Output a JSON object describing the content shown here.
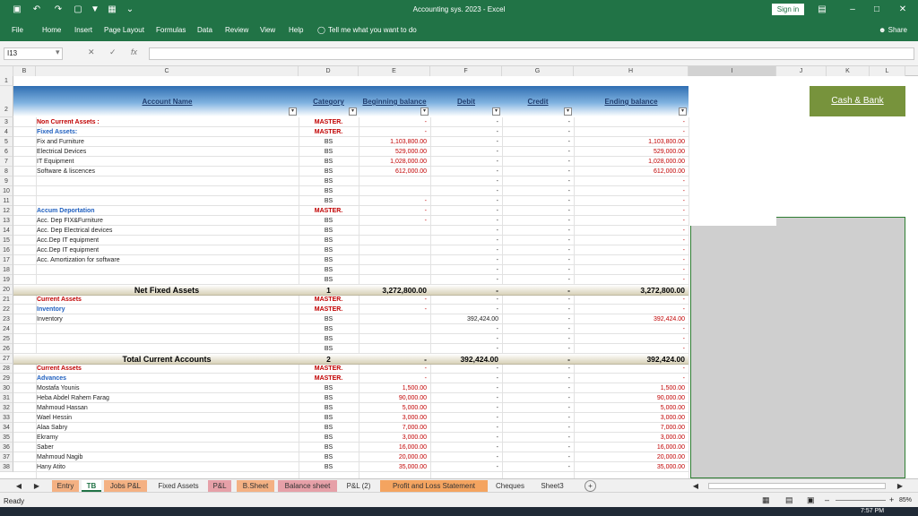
{
  "window": {
    "title": "Accounting sys. 2023  -  Excel",
    "signin": "Sign in"
  },
  "ribbon": {
    "tabs": [
      "File",
      "Home",
      "Insert",
      "Page Layout",
      "Formulas",
      "Data",
      "Review",
      "View",
      "Help"
    ],
    "tell_me": "Tell me what you want to do",
    "share": "Share"
  },
  "formula_bar": {
    "name_box": "I13",
    "formula": ""
  },
  "columns": [
    "B",
    "C",
    "D",
    "E",
    "F",
    "G",
    "H",
    "I",
    "J",
    "K",
    "L"
  ],
  "headers": {
    "account": "Account Name",
    "category": "Category",
    "beginning": "Beginning balance",
    "debit": "Debit",
    "credit": "Credit",
    "ending": "Ending balance"
  },
  "cash_bank": "Cash & Bank",
  "rows": [
    {
      "n": "3",
      "name": "Non Current Assets :",
      "cat": "MASTER.",
      "beg": "-",
      "deb": "-",
      "cre": "-",
      "end": "-",
      "style": "sect-red"
    },
    {
      "n": "4",
      "name": "Fixed Assets:",
      "cat": "MASTER.",
      "beg": "-",
      "deb": "-",
      "cre": "-",
      "end": "-",
      "style": "sect-blue"
    },
    {
      "n": "5",
      "name": "Fix and Furniture",
      "cat": "BS",
      "beg": "1,103,800.00",
      "deb": "-",
      "cre": "-",
      "end": "1,103,800.00",
      "style": ""
    },
    {
      "n": "6",
      "name": "Electrical Devices",
      "cat": "BS",
      "beg": "529,000.00",
      "deb": "-",
      "cre": "-",
      "end": "529,000.00",
      "style": ""
    },
    {
      "n": "7",
      "name": "IT Equipment",
      "cat": "BS",
      "beg": "1,028,000.00",
      "deb": "-",
      "cre": "-",
      "end": "1,028,000.00",
      "style": ""
    },
    {
      "n": "8",
      "name": "Software & liscences",
      "cat": "BS",
      "beg": "612,000.00",
      "deb": "-",
      "cre": "-",
      "end": "612,000.00",
      "style": ""
    },
    {
      "n": "9",
      "name": "",
      "cat": "BS",
      "beg": "",
      "deb": "-",
      "cre": "-",
      "end": "-",
      "style": ""
    },
    {
      "n": "10",
      "name": "",
      "cat": "BS",
      "beg": "",
      "deb": "-",
      "cre": "-",
      "end": "-",
      "style": ""
    },
    {
      "n": "11",
      "name": "",
      "cat": "BS",
      "beg": "-",
      "deb": "-",
      "cre": "-",
      "end": "-",
      "style": ""
    },
    {
      "n": "12",
      "name": "Accum Deportation",
      "cat": "MASTER.",
      "beg": "-",
      "deb": "-",
      "cre": "-",
      "end": "-",
      "style": "sect-blue"
    },
    {
      "n": "13",
      "name": "Acc. Dep  FIX&Furniture",
      "cat": "BS",
      "beg": "-",
      "deb": "-",
      "cre": "-",
      "end": "-",
      "style": ""
    },
    {
      "n": "14",
      "name": "Acc. Dep Electrical devices",
      "cat": "BS",
      "beg": "",
      "deb": "-",
      "cre": "-",
      "end": "-",
      "style": ""
    },
    {
      "n": "15",
      "name": "Acc.Dep IT equipment",
      "cat": "BS",
      "beg": "",
      "deb": "-",
      "cre": "-",
      "end": "-",
      "style": ""
    },
    {
      "n": "16",
      "name": "Acc.Dep IT equipment",
      "cat": "BS",
      "beg": "",
      "deb": "-",
      "cre": "-",
      "end": "-",
      "style": ""
    },
    {
      "n": "17",
      "name": "Acc. Amortization for software",
      "cat": "BS",
      "beg": "",
      "deb": "-",
      "cre": "-",
      "end": "-",
      "style": ""
    },
    {
      "n": "18",
      "name": "",
      "cat": "BS",
      "beg": "",
      "deb": "-",
      "cre": "-",
      "end": "-",
      "style": ""
    },
    {
      "n": "19",
      "name": "",
      "cat": "BS",
      "beg": "",
      "deb": "-",
      "cre": "-",
      "end": "-",
      "style": ""
    },
    {
      "n": "20",
      "name": "Net Fixed Assets",
      "cat": "1",
      "beg": "3,272,800.00",
      "deb": "-",
      "cre": "-",
      "end": "3,272,800.00",
      "style": "total"
    },
    {
      "n": "21",
      "name": "Current Assets",
      "cat": "MASTER.",
      "beg": "-",
      "deb": "-",
      "cre": "-",
      "end": "-",
      "style": "sect-red"
    },
    {
      "n": "22",
      "name": "Inventory",
      "cat": "MASTER.",
      "beg": "-",
      "deb": "-",
      "cre": "-",
      "end": "-",
      "style": "sect-blue"
    },
    {
      "n": "23",
      "name": "Inventory",
      "cat": "BS",
      "beg": "",
      "deb": "392,424.00",
      "cre": "-",
      "end": "392,424.00",
      "style": ""
    },
    {
      "n": "24",
      "name": "",
      "cat": "BS",
      "beg": "",
      "deb": "-",
      "cre": "-",
      "end": "-",
      "style": ""
    },
    {
      "n": "25",
      "name": "",
      "cat": "BS",
      "beg": "",
      "deb": "-",
      "cre": "-",
      "end": "-",
      "style": ""
    },
    {
      "n": "26",
      "name": "",
      "cat": "BS",
      "beg": "",
      "deb": "-",
      "cre": "-",
      "end": "-",
      "style": ""
    },
    {
      "n": "27",
      "name": "Total Current Accounts",
      "cat": "2",
      "beg": "-",
      "deb": "392,424.00",
      "cre": "-",
      "end": "392,424.00",
      "style": "total"
    },
    {
      "n": "28",
      "name": "Current Assets",
      "cat": "MASTER.",
      "beg": "-",
      "deb": "-",
      "cre": "-",
      "end": "-",
      "style": "sect-red"
    },
    {
      "n": "29",
      "name": "Advances",
      "cat": "MASTER.",
      "beg": "-",
      "deb": "-",
      "cre": "-",
      "end": "-",
      "style": "sect-blue"
    },
    {
      "n": "30",
      "name": "Mostafa Younis",
      "cat": "BS",
      "beg": "1,500.00",
      "deb": "-",
      "cre": "-",
      "end": "1,500.00",
      "style": ""
    },
    {
      "n": "31",
      "name": "Heba Abdel Rahem Farag",
      "cat": "BS",
      "beg": "90,000.00",
      "deb": "-",
      "cre": "-",
      "end": "90,000.00",
      "style": ""
    },
    {
      "n": "32",
      "name": "Mahmoud Hassan",
      "cat": "BS",
      "beg": "5,000.00",
      "deb": "-",
      "cre": "-",
      "end": "5,000.00",
      "style": ""
    },
    {
      "n": "33",
      "name": "Wael Hessin",
      "cat": "BS",
      "beg": "3,000.00",
      "deb": "-",
      "cre": "-",
      "end": "3,000.00",
      "style": ""
    },
    {
      "n": "34",
      "name": "Alaa Sabry",
      "cat": "BS",
      "beg": "7,000.00",
      "deb": "-",
      "cre": "-",
      "end": "7,000.00",
      "style": ""
    },
    {
      "n": "35",
      "name": "Ekramy",
      "cat": "BS",
      "beg": "3,000.00",
      "deb": "-",
      "cre": "-",
      "end": "3,000.00",
      "style": ""
    },
    {
      "n": "36",
      "name": "Saber",
      "cat": "BS",
      "beg": "16,000.00",
      "deb": "-",
      "cre": "-",
      "end": "16,000.00",
      "style": ""
    },
    {
      "n": "37",
      "name": "Mahmoud Nagib",
      "cat": "BS",
      "beg": "20,000.00",
      "deb": "-",
      "cre": "-",
      "end": "20,000.00",
      "style": ""
    },
    {
      "n": "38",
      "name": "Hany Atito",
      "cat": "BS",
      "beg": "35,000.00",
      "deb": "-",
      "cre": "-",
      "end": "35,000.00",
      "style": ""
    }
  ],
  "sheet_tabs": [
    {
      "label": "Entry",
      "color": "#f4b183"
    },
    {
      "label": "TB",
      "color": "#ffffff",
      "active": true
    },
    {
      "label": "Jobs P&L",
      "color": "#f4b183"
    },
    {
      "label": "Fixed Assets",
      "color": "#f0f0f0"
    },
    {
      "label": "P&L",
      "color": "#e6a0a8"
    },
    {
      "label": "B.Sheet",
      "color": "#f4b183"
    },
    {
      "label": "Balance sheet",
      "color": "#e6a0a8"
    },
    {
      "label": "P&L (2)",
      "color": "#f0f0f0"
    },
    {
      "label": "Profit and Loss Statement",
      "color": "#f4a460"
    },
    {
      "label": "Cheques",
      "color": "#f0f0f0"
    },
    {
      "label": "Sheet3",
      "color": "#f0f0f0"
    }
  ],
  "status": {
    "ready": "Ready",
    "zoom": "85%",
    "clock": "7:57 PM"
  }
}
